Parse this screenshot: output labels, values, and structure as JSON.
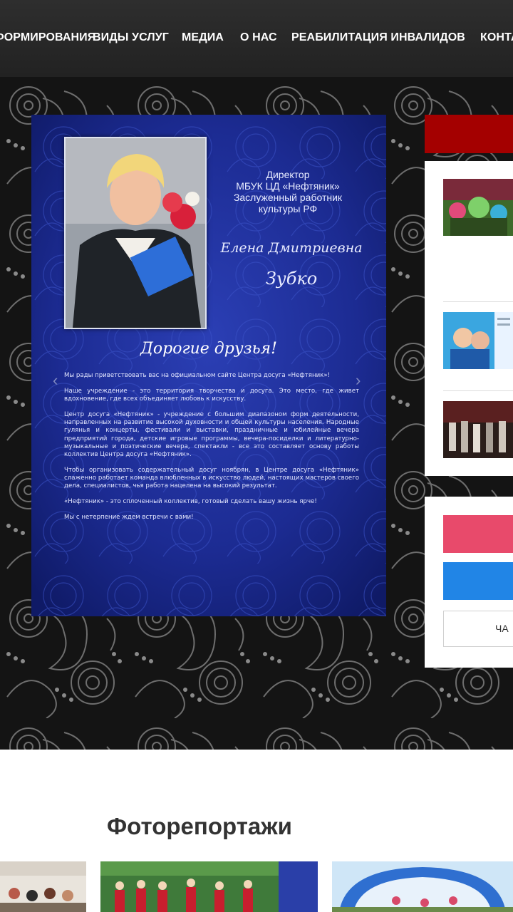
{
  "nav": {
    "items": [
      "ФОРМИРОВАНИЯ",
      "ВИДЫ УСЛУГ",
      "МЕДИА",
      "О НАС",
      "РЕАБИЛИТАЦИЯ ИНВАЛИДОВ",
      "КОНТАКТЫ"
    ]
  },
  "banner": {
    "director_lines": [
      "Директор",
      "МБУК ЦД «Нефтяник»",
      "Заслуженный работник",
      "культуры РФ"
    ],
    "name": "Елена Дмитриевна",
    "surname": "Зубко",
    "greeting": "Дорогие друзья!",
    "paragraphs": [
      "Мы рады приветствовать вас на официальном сайте Центра досуга «Нефтяник»!",
      "Наше учреждение - это территория творчества и досуга. Это место, где живет вдохновение, где всех объединяет любовь к искусству.",
      "Центр досуга «Нефтяник» - учреждение с большим диапазоном форм деятельности, направленных на развитие высокой духовности и общей культуры населения. Народные гулянья и концерты, фестивали и выставки, праздничные и юбилейные вечера предприятий города, детские игровые программы, вечера-посиделки и литературно-музыкальные и поэтические вечера, спектакли - все это составляет основу работы коллектив Центра досуга «Нефтяник».",
      "Чтобы организовать содержательный досуг ноябрян, в Центре досуга «Нефтяник» слаженно работает команда влюбленных в искусство людей, настоящих мастеров своего дела, специалистов, чья работа нацелена на высокий результат.",
      "«Нефтяник» - это сплоченный коллектив, готовый сделать вашу жизнь ярче!",
      "Мы с нетерпение ждем встречи с вами!"
    ]
  },
  "sidebar": {
    "outline_button_label": "ЧА"
  },
  "photo_reports": {
    "title": "Фоторепортажи"
  },
  "colors": {
    "nav_bg": "#2a2a2a",
    "banner_blue": "#1b2a8c",
    "sidebar_red": "#a40000",
    "button_pink": "#e84a6b",
    "button_blue": "#2185e6"
  }
}
